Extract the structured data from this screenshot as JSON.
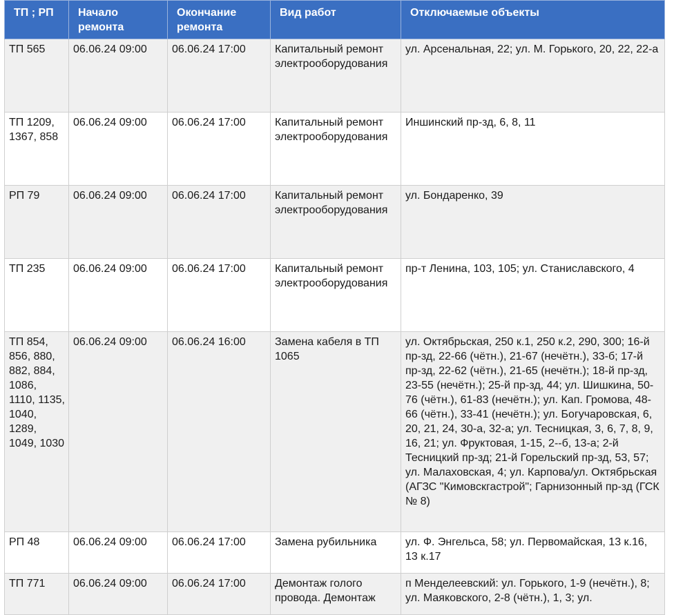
{
  "table": {
    "headers": [
      "ТП ; РП",
      "Начало ремонта",
      "Окончание ремонта",
      "Вид работ",
      "Отключаемые объекты"
    ],
    "rows": [
      {
        "tp": "ТП 565",
        "start": "06.06.24 09:00",
        "end": "06.06.24 17:00",
        "work": "Капитальный ремонт электрооборудования",
        "objects": "ул. Арсенальная, 22; ул. М. Горького, 20, 22, 22-а"
      },
      {
        "tp": "ТП 1209, 1367, 858",
        "start": "06.06.24 09:00",
        "end": "06.06.24 17:00",
        "work": "Капитальный ремонт электрооборудования",
        "objects": "Иншинский пр-зд, 6, 8, 11"
      },
      {
        "tp": "РП 79",
        "start": "06.06.24 09:00",
        "end": "06.06.24 17:00",
        "work": "Капитальный ремонт электрооборудования",
        "objects": "ул. Бондаренко, 39"
      },
      {
        "tp": "ТП 235",
        "start": "06.06.24 09:00",
        "end": "06.06.24 17:00",
        "work": "Капитальный ремонт электрооборудования",
        "objects": "пр-т Ленина, 103, 105; ул. Станиславского, 4"
      },
      {
        "tp": "ТП 854, 856, 880, 882, 884, 1086, 1110, 1135, 1040, 1289, 1049, 1030",
        "start": "06.06.24 09:00",
        "end": "06.06.24 16:00",
        "work": "Замена кабеля в ТП 1065",
        "objects": "ул. Октябрьская, 250 к.1, 250 к.2, 290, 300; 16-й пр-зд, 22-66 (чётн.), 21-67 (нечётн.), 33-б; 17-й пр-зд, 22-62 (чётн.), 21-65 (нечётн.); 18-й пр-зд, 23-55 (нечётн.); 25-й пр-зд, 44; ул. Шишкина, 50-76 (чётн.), 61-83 (нечётн.); ул. Кап. Громова, 48-66 (чётн.), 33-41 (нечётн.); ул. Богучаровская, 6, 20, 21, 24, 30-а, 32-а; ул. Тесницкая, 3, 6, 7, 8, 9, 16, 21; ул. Фруктовая, 1-15, 2--б, 13-а; 2-й Тесницкий пр-зд; 21-й Горельский пр-зд, 53, 57; ул. Малаховская, 4; ул. Карпова/ул. Октябрьская (АГЗС \"Кимовскгастрой\"; Гарнизонный пр-зд (ГСК № 8)"
      },
      {
        "tp": "РП 48",
        "start": "06.06.24 09:00",
        "end": "06.06.24 17:00",
        "work": "Замена рубильника",
        "objects": "ул. Ф. Энгельса, 58; ул. Первомайская, 13 к.16, 13 к.17"
      },
      {
        "tp": "ТП 771",
        "start": "06.06.24 09:00",
        "end": "06.06.24 17:00",
        "work": "Демонтаж голого провода. Демонтаж",
        "objects": "п Менделеевский: ул. Горького, 1-9 (нечётн.), 8; ул. Маяковского, 2-8 (чётн.), 1, 3; ул."
      }
    ]
  }
}
